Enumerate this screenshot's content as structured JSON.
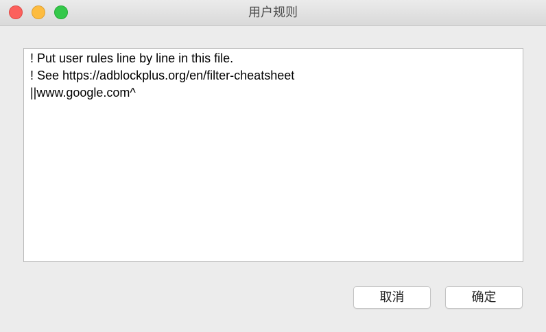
{
  "window": {
    "title": "用户规则"
  },
  "editor": {
    "lines": [
      "! Put user rules line by line in this file.",
      "! See https://adblockplus.org/en/filter-cheatsheet",
      "||www.google.com^"
    ]
  },
  "buttons": {
    "cancel_label": "取消",
    "ok_label": "确定"
  },
  "colors": {
    "close": "#fc605c",
    "minimize": "#fdbc40",
    "zoom": "#34c84a"
  },
  "icons": {
    "close": "close-icon",
    "minimize": "minimize-icon",
    "zoom": "zoom-icon"
  }
}
